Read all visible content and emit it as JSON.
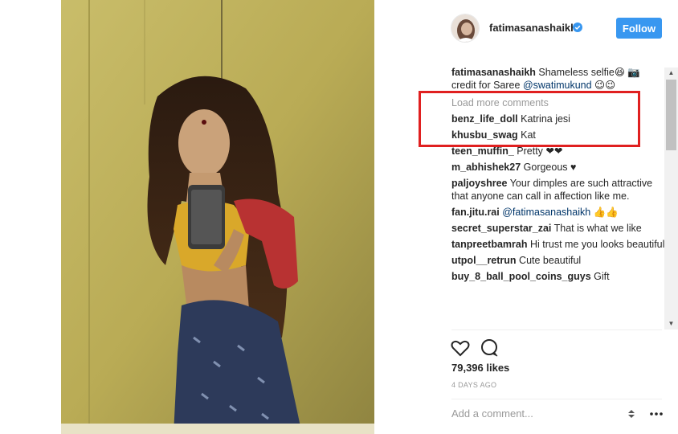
{
  "post": {
    "username": "fatimasanashaikh",
    "verified": true,
    "follow_label": "Follow",
    "caption": {
      "author": "fatimasanashaikh",
      "text_before": " Shameless selfie😆 📷 credit for Saree ",
      "mention": "@swatimukund",
      "text_after": " 😉😉"
    },
    "load_more_label": "Load more comments",
    "comments": [
      {
        "author": "benz_life_doll",
        "text": " Katrina jesi"
      },
      {
        "author": "khusbu_swag",
        "text": " Kat"
      },
      {
        "author": "teen_muffin_",
        "text": " Pretty ❤❤"
      },
      {
        "author": "m_abhishek27",
        "text": " Gorgeous ♥"
      },
      {
        "author": "paljoyshree",
        "text": " Your dimples are such attractive that anyone can call in affection like me."
      },
      {
        "author": "fan.jitu.rai",
        "text": " ",
        "mention": "@fatimasanashaikh",
        "text_after": " 👍👍"
      },
      {
        "author": "secret_superstar_zai",
        "text": " That is what we like"
      },
      {
        "author": "tanpreetbamrah",
        "text": " Hi trust me you looks beautiful"
      },
      {
        "author": "utpol__retrun",
        "text": " Cute beautiful"
      },
      {
        "author": "buy_8_ball_pool_coins_guys",
        "text": " Gift"
      }
    ],
    "likes": "79,396 likes",
    "time": "4 DAYS AGO",
    "add_comment_placeholder": "Add a comment..."
  },
  "icons": {
    "like": "heart-icon",
    "comment": "comment-bubble-icon",
    "verified": "verified-badge-icon",
    "more": "more-options-icon"
  },
  "colors": {
    "follow_button": "#3897f0",
    "highlight_box": "#e02020",
    "mention": "#003569",
    "muted_text": "#999999"
  }
}
